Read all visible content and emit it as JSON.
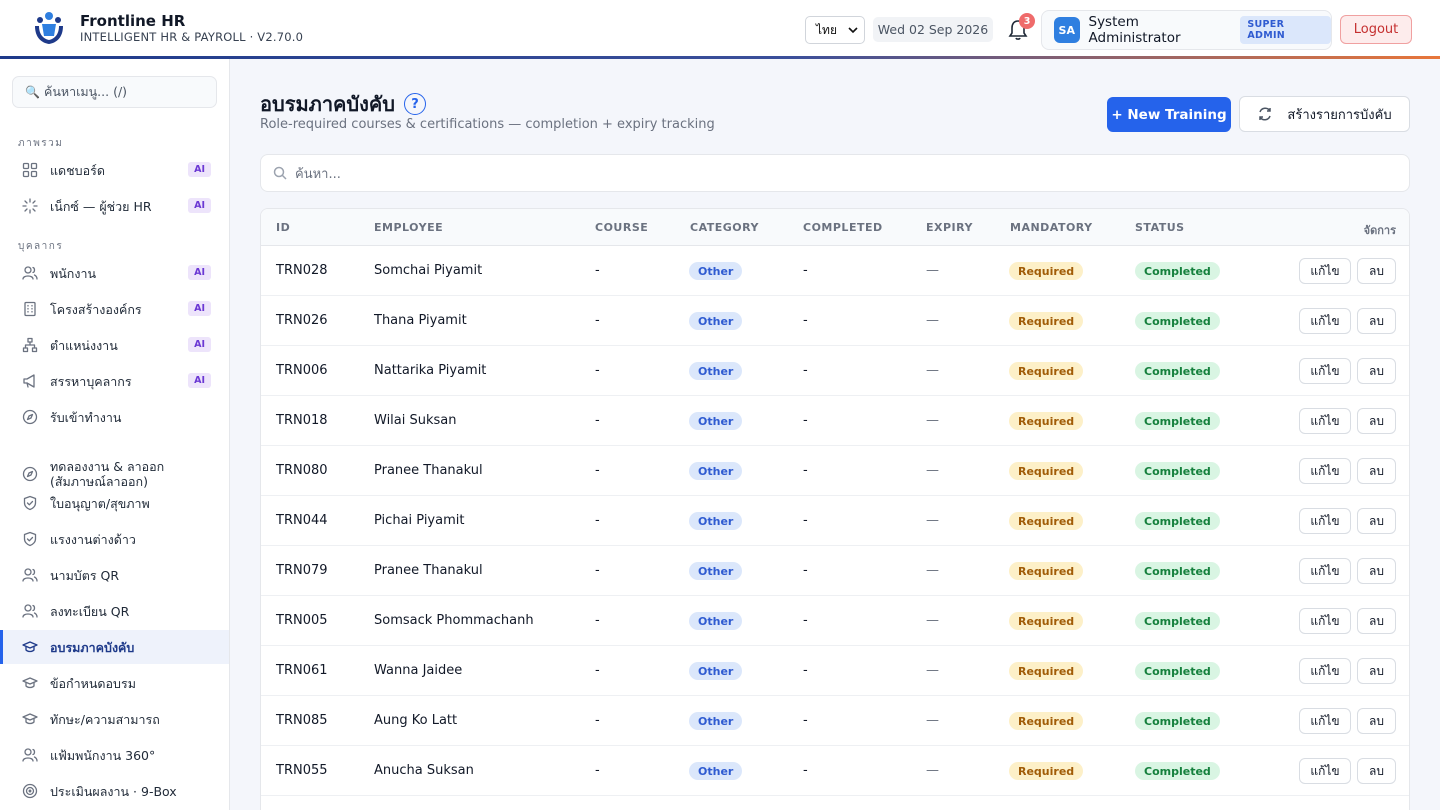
{
  "header": {
    "app_name": "Frontline HR",
    "app_subtitle": "INTELLIGENT HR & PAYROLL · V2.70.0",
    "language": "ไทย",
    "date": "Wed 02 Sep 2026",
    "notification_count": "3",
    "user_initials": "SA",
    "user_name": "System Administrator",
    "user_role": "SUPER ADMIN",
    "logout_label": "Logout"
  },
  "sidebar": {
    "search_placeholder": "ค้นหาเมนู... (/)",
    "sections": [
      "ภาพรวม",
      "บุคลากร"
    ],
    "ai_badge": "AI",
    "items": [
      {
        "label": "แดชบอร์ด",
        "icon": "grid-icon",
        "ai": true
      },
      {
        "label": "เน็กซ์ — ผู้ช่วย HR",
        "icon": "sparkle-icon",
        "ai": true
      },
      {
        "label": "พนักงาน",
        "icon": "users-icon",
        "ai": true
      },
      {
        "label": "โครงสร้างองค์กร",
        "icon": "building-icon",
        "ai": true
      },
      {
        "label": "ตำแหน่งงาน",
        "icon": "org-chart-icon",
        "ai": true
      },
      {
        "label": "สรรหาบุคลากร",
        "icon": "megaphone-icon",
        "ai": true
      },
      {
        "label": "รับเข้าทำงาน",
        "icon": "compass-icon",
        "ai": false
      },
      {
        "label": "ทดลองงาน & ลาออก (สัมภาษณ์ลาออก)",
        "icon": "compass-icon",
        "ai": false
      },
      {
        "label": "ใบอนุญาต/สุขภาพ",
        "icon": "shield-icon",
        "ai": false
      },
      {
        "label": "แรงงานต่างด้าว",
        "icon": "shield-icon",
        "ai": false
      },
      {
        "label": "นามบัตร QR",
        "icon": "users-icon",
        "ai": false
      },
      {
        "label": "ลงทะเบียน QR",
        "icon": "users-icon",
        "ai": false
      },
      {
        "label": "อบรมภาคบังคับ",
        "icon": "graduation-cap-icon",
        "ai": false,
        "active": true
      },
      {
        "label": "ข้อกำหนดอบรม",
        "icon": "graduation-cap-icon",
        "ai": false
      },
      {
        "label": "ทักษะ/ความสามารถ",
        "icon": "graduation-cap-icon",
        "ai": false
      },
      {
        "label": "แฟ้มพนักงาน 360°",
        "icon": "users-icon",
        "ai": false
      },
      {
        "label": "ประเมินผลงาน · 9-Box",
        "icon": "target-icon",
        "ai": false
      }
    ]
  },
  "main": {
    "title": "อบรมภาคบังคับ",
    "help": "?",
    "subtitle": "Role-required courses & certifications — completion + expiry tracking",
    "new_button": "+ New Training",
    "generate_button": "สร้างรายการบังคับ",
    "search_placeholder": "ค้นหา...",
    "columns": [
      "ID",
      "EMPLOYEE",
      "COURSE",
      "CATEGORY",
      "COMPLETED",
      "EXPIRY",
      "MANDATORY",
      "STATUS",
      "จัดการ"
    ],
    "edit_label": "แก้ไข",
    "delete_label": "ลบ",
    "rows": [
      {
        "id": "TRN028",
        "employee": "Somchai Piyamit",
        "course": "-",
        "category": "Other",
        "completed": "-",
        "expiry": "—",
        "mandatory": "Required",
        "status": "Completed"
      },
      {
        "id": "TRN026",
        "employee": "Thana Piyamit",
        "course": "-",
        "category": "Other",
        "completed": "-",
        "expiry": "—",
        "mandatory": "Required",
        "status": "Completed"
      },
      {
        "id": "TRN006",
        "employee": "Nattarika Piyamit",
        "course": "-",
        "category": "Other",
        "completed": "-",
        "expiry": "—",
        "mandatory": "Required",
        "status": "Completed"
      },
      {
        "id": "TRN018",
        "employee": "Wilai Suksan",
        "course": "-",
        "category": "Other",
        "completed": "-",
        "expiry": "—",
        "mandatory": "Required",
        "status": "Completed"
      },
      {
        "id": "TRN080",
        "employee": "Pranee Thanakul",
        "course": "-",
        "category": "Other",
        "completed": "-",
        "expiry": "—",
        "mandatory": "Required",
        "status": "Completed"
      },
      {
        "id": "TRN044",
        "employee": "Pichai Piyamit",
        "course": "-",
        "category": "Other",
        "completed": "-",
        "expiry": "—",
        "mandatory": "Required",
        "status": "Completed"
      },
      {
        "id": "TRN079",
        "employee": "Pranee Thanakul",
        "course": "-",
        "category": "Other",
        "completed": "-",
        "expiry": "—",
        "mandatory": "Required",
        "status": "Completed"
      },
      {
        "id": "TRN005",
        "employee": "Somsack Phommachanh",
        "course": "-",
        "category": "Other",
        "completed": "-",
        "expiry": "—",
        "mandatory": "Required",
        "status": "Completed"
      },
      {
        "id": "TRN061",
        "employee": "Wanna Jaidee",
        "course": "-",
        "category": "Other",
        "completed": "-",
        "expiry": "—",
        "mandatory": "Required",
        "status": "Completed"
      },
      {
        "id": "TRN085",
        "employee": "Aung Ko Latt",
        "course": "-",
        "category": "Other",
        "completed": "-",
        "expiry": "—",
        "mandatory": "Required",
        "status": "Completed"
      },
      {
        "id": "TRN055",
        "employee": "Anucha Suksan",
        "course": "-",
        "category": "Other",
        "completed": "-",
        "expiry": "—",
        "mandatory": "Required",
        "status": "Completed"
      }
    ]
  }
}
